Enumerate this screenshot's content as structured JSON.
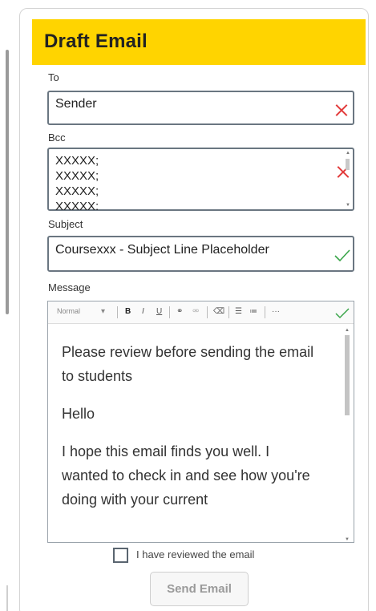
{
  "header": {
    "title": "Draft Email"
  },
  "to": {
    "label": "To",
    "value": "Sender",
    "status_icon": "x-icon"
  },
  "bcc": {
    "label": "Bcc",
    "lines": [
      "XXXXX;",
      "XXXXX;",
      "XXXXX;",
      "XXXXX;"
    ],
    "status_icon": "x-icon"
  },
  "subject": {
    "label": "Subject",
    "value": "Coursexxx - Subject Line Placeholder",
    "status_icon": "check-icon"
  },
  "message": {
    "label": "Message",
    "toolbar": {
      "format_select": "Normal",
      "bold": "B",
      "italic": "I",
      "underline": "U",
      "more": "···"
    },
    "paragraphs": [
      "Please review before sending the email to students",
      "Hello",
      "I hope this email finds you well. I wanted to check in and see how you're doing with your current"
    ],
    "status_icon": "check-icon"
  },
  "review_checkbox": {
    "label": "I have reviewed the email",
    "checked": false
  },
  "send_button": {
    "label": "Send Email",
    "enabled": false
  },
  "colors": {
    "header_bg": "#ffd400",
    "error": "#e23a3a",
    "ok": "#3aa54a",
    "field_border": "#6a7681"
  }
}
